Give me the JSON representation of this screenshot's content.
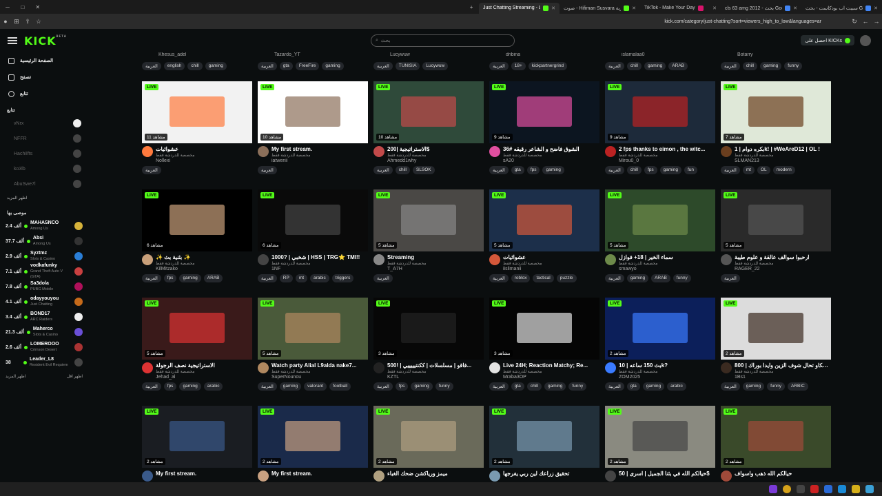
{
  "browser": {
    "tabs": [
      {
        "label": "Just Chatting Streaming - Live",
        "active": true,
        "color": "#53fc18"
      },
      {
        "label": "صوت - Hifiman Susvara تجربة",
        "active": false,
        "color": "#53fc18"
      },
      {
        "label": "TikTok - Make Your Day",
        "active": false,
        "color": "#d8146b"
      },
      {
        "label": "cls 63 amg 2012 - بحث Google",
        "active": false,
        "color": "#4285f4"
      },
      {
        "label": "سبيت اب بودكاست - بحث Google",
        "active": false,
        "color": "#4285f4"
      }
    ],
    "url": "kick.com/category/just-chatting?sort=viewers_high_to_low&languages=ar"
  },
  "header": {
    "logo": "KICK",
    "logo_badge": "BETA",
    "search_placeholder": "بحث",
    "get_kicks": "احصل على KICKs"
  },
  "sidebar": {
    "nav": [
      "الصفحة الرئيسية",
      "تصفح",
      "تتابع"
    ],
    "following_title": "تتابع",
    "following": [
      "vNrx",
      "NFFR",
      "HachiIfts",
      "ko3lb",
      "AbuSwe7l"
    ],
    "show_more": "اظهر المزيد",
    "recommended_title": "موصى بها",
    "recommended": [
      {
        "name": "MAHASNCO",
        "count": "2.4 ألف",
        "category": "Among Us",
        "color": "#d6b23a"
      },
      {
        "name": "Absi",
        "count": "37.7 ألف",
        "category": "Among Us",
        "color": "#333"
      },
      {
        "name": "Syztmz",
        "count": "2.9 ألف",
        "category": "Slots & Casino",
        "color": "#2a7ed6"
      },
      {
        "name": "vodkafunky",
        "count": "7.1 ألف",
        "category": "Grand Theft Auto V (GTA)",
        "color": "#c94040"
      },
      {
        "name": "Sa3dola",
        "count": "7.8 ألف",
        "category": "PUBG Mobile",
        "color": "#b0105a"
      },
      {
        "name": "odayyouyou",
        "count": "4.1 ألف",
        "category": "Just Chatting",
        "color": "#c66a1a"
      },
      {
        "name": "BOND17",
        "count": "3.4 ألف",
        "category": "ARC Raiders",
        "color": "#eee"
      },
      {
        "name": "Maherco",
        "count": "21.3 ألف",
        "category": "Slots & Casino",
        "color": "#6a4fd6"
      },
      {
        "name": "LOMEROOO",
        "count": "2.6 ألف",
        "category": "Crimson Desert",
        "color": "#a33"
      },
      {
        "name": "Leader_L8",
        "count": "38",
        "category": "Resident Evil Requiem",
        "color": "#444"
      }
    ],
    "footer_left": "اظهر المزيد",
    "footer_right": "اظهر اقل"
  },
  "toprow": [
    {
      "channel": "Khesus_adel",
      "tags": [
        "العربية",
        "english",
        "chill",
        "gaming"
      ]
    },
    {
      "channel": "Tazardo_YT",
      "tags": [
        "العربية",
        "gta",
        "FreeFire",
        "gaming"
      ]
    },
    {
      "channel": "Lucywuw",
      "tags": [
        "العربية",
        "TUNISIA",
        "Lucywuw"
      ]
    },
    {
      "channel": "dribina",
      "tags": [
        "العربية",
        "18+",
        "kickpartnergrind"
      ]
    },
    {
      "channel": "islamalaa0",
      "tags": [
        "العربية",
        "chill",
        "gaming",
        "ARAB"
      ]
    },
    {
      "channel": "Botarry",
      "tags": [
        "العربية",
        "chill",
        "gaming",
        "funny"
      ]
    }
  ],
  "live_label": "LIVE",
  "category_label": "مخصصة للدردشة فقط",
  "cards": [
    {
      "title": "عشوائيات",
      "channel": "Nollexi",
      "viewers": "11 مشاهد",
      "tags": [
        "العربية"
      ],
      "thumb": "#f2f2f2",
      "accent": "#ff7a3d"
    },
    {
      "title": "My first stream.",
      "channel": "iatwenii",
      "viewers": "10 مشاهد",
      "tags": [
        "العربية"
      ],
      "thumb": "#ffffff",
      "accent": "#8b6f5a"
    },
    {
      "title": "الاستراتيجية |200$",
      "channel": "Ahmedd1why",
      "viewers": "10 مشاهد",
      "tags": [
        "العربية",
        "chill",
        "SLSOK"
      ],
      "thumb": "#2f4a3a",
      "accent": "#c24a4a"
    },
    {
      "title": "الشوق فاضح و الشاعر رقيقه #36",
      "channel": "sA20",
      "viewers": "9 مشاهد",
      "tags": [
        "العربية",
        "gta",
        "fps",
        "gaming"
      ],
      "thumb": "#0c1520",
      "accent": "#e04fa0"
    },
    {
      "title": "2 fps thanks to eimon , the witc...",
      "channel": "Mirou0_0",
      "viewers": "9 مشاهد",
      "tags": [
        "العربية",
        "chill",
        "fps",
        "gaming",
        "fun"
      ],
      "thumb": "#1d2a3a",
      "accent": "#b22"
    },
    {
      "title": "بكره دوام | 1k! | #WeAreD12 | OL !",
      "channel": "SLMAN213",
      "viewers": "7 مشاهد",
      "tags": [
        "العربية",
        "mt",
        "OL",
        "modern"
      ],
      "thumb": "#dfe8d8",
      "accent": "#6a3e1e"
    },
    {
      "title": "✨ بثنية بث ✨",
      "channel": "KilMitzako",
      "viewers": "6 مشاهد",
      "tags": [
        "العربية",
        "fps",
        "gaming",
        "ARAB"
      ],
      "thumb": "#000000",
      "accent": "#c9a07a"
    },
    {
      "title": "شخبي | ?1000 | HSS | TRG⭐ TMI!!",
      "channel": "1NF",
      "viewers": "6 مشاهد",
      "tags": [
        "العربية",
        "RP",
        "mt",
        "arabic",
        "triggers"
      ],
      "thumb": "#0a0a0a",
      "accent": "#444"
    },
    {
      "title": "Streaming",
      "channel": "T_A7H",
      "viewers": "5 مشاهد",
      "tags": [
        "العربية"
      ],
      "thumb": "#4a4845",
      "accent": "#888"
    },
    {
      "title": "عشوائيات",
      "channel": "iislimanii",
      "viewers": "5 مشاهد",
      "tags": [
        "العربية",
        "roblox",
        "tactical",
        "puzzle"
      ],
      "thumb": "#1c2f4a",
      "accent": "#d4583a"
    },
    {
      "title": "سماء الخير | 18+ فوازل",
      "channel": "smawyo",
      "viewers": "5 مشاهد",
      "tags": [
        "العربية",
        "gaming",
        "ARAB",
        "funny"
      ],
      "thumb": "#2d4a2a",
      "accent": "#6d8a4a"
    },
    {
      "title": "ارحبوا سوالف عالقة و علوم طيبة",
      "channel": "RAGER_22",
      "viewers": "5 مشاهد",
      "tags": [
        "العربية"
      ],
      "thumb": "#2a2a2a",
      "accent": "#555"
    },
    {
      "title": "الاستراتيجية نصف الرجولة",
      "channel": "Jehad_al",
      "viewers": "5 مشاهد",
      "tags": [
        "العربية",
        "fps",
        "gaming",
        "arabic"
      ],
      "thumb": "#3a1a1a",
      "accent": "#d33"
    },
    {
      "title": "Watch party Alial L9alda nake7...",
      "channel": "SuperNounou",
      "viewers": "5 مشاهد",
      "tags": [
        "العربية",
        "gaming",
        "valorant",
        "football"
      ],
      "thumb": "#4a5a3a",
      "accent": "#b08860"
    },
    {
      "title": "500! | فاقو | مسلسلات | ككنتيييييي...",
      "channel": "KZTL",
      "viewers": "3 مشاهد",
      "tags": [
        "العربية",
        "fps",
        "gaming",
        "funny"
      ],
      "thumb": "#070707",
      "accent": "#222"
    },
    {
      "title": "Live 24H; Reaction Matchy; Re...",
      "channel": "Mraba3OP",
      "viewers": "3 مشاهد",
      "tags": [
        "العربية",
        "gta",
        "chill",
        "gaming",
        "funny"
      ],
      "thumb": "#050505",
      "accent": "#e3e3e3"
    },
    {
      "title": "بث 150 ساعه | 10k?",
      "channel": "ZOM2025",
      "viewers": "2 مشاهد",
      "tags": [
        "العربية",
        "gta",
        "gaming",
        "arabic"
      ],
      "thumb": "#0c1f5a",
      "accent": "#3a7bff"
    },
    {
      "title": "بلكاو تحال شوف الزين وايدا بوراك | 800$",
      "channel": "1Bs1",
      "viewers": "2 مشاهد",
      "tags": [
        "العربية",
        "gaming",
        "funny",
        "ARBIC"
      ],
      "thumb": "#dcdcdc",
      "accent": "#3a2a20"
    },
    {
      "title": "My first stream.",
      "channel": "",
      "viewers": "2 مشاهد",
      "tags": [],
      "thumb": "#1a1d22",
      "accent": "#3a5a8a"
    },
    {
      "title": "My first stream.",
      "channel": "",
      "viewers": "2 مشاهد",
      "tags": [],
      "thumb": "#1a2a4a",
      "accent": "#c8a080"
    },
    {
      "title": "ميمز ورياكشن ضحك الغباء",
      "channel": "",
      "viewers": "2 مشاهد",
      "tags": [],
      "thumb": "#6a6a5a",
      "accent": "#b0a080"
    },
    {
      "title": "تحقيق زراعك لين ربي يفرجها",
      "channel": "",
      "viewers": "2 مشاهد",
      "tags": [],
      "thumb": "#22303a",
      "accent": "#7a9ab0"
    },
    {
      "title": "حيالكم الله في بثنا الجميل | اسرى | 50$",
      "channel": "",
      "viewers": "2 مشاهد",
      "tags": [],
      "thumb": "#8a8a80",
      "accent": "#444"
    },
    {
      "title": "حيالكم الله ذهب واسواف",
      "channel": "",
      "viewers": "2 مشاهد",
      "tags": [],
      "thumb": "#3a4a2a",
      "accent": "#a04a3a"
    }
  ]
}
